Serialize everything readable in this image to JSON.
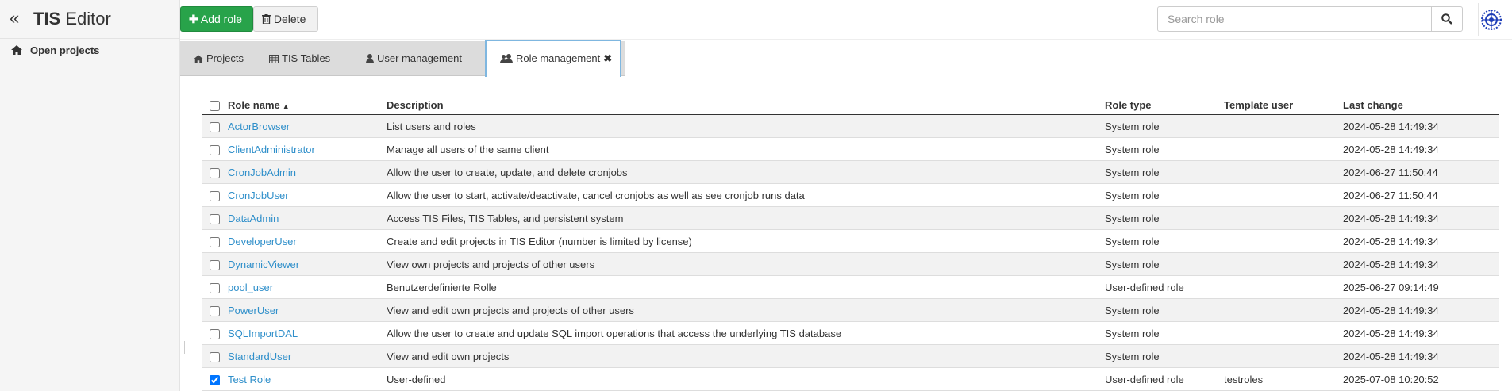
{
  "app": {
    "title_bold": "TIS",
    "title_rest": " Editor"
  },
  "sidebar": {
    "items": [
      {
        "label": "Open projects",
        "icon": "home-icon"
      }
    ]
  },
  "toolbar": {
    "add_label": "Add role",
    "delete_label": "Delete"
  },
  "search": {
    "placeholder": "Search role"
  },
  "tabs": [
    {
      "label": "Projects",
      "icon": "home-icon"
    },
    {
      "label": "TIS Tables",
      "icon": "table-icon"
    },
    {
      "label": "User management",
      "icon": "user-icon"
    },
    {
      "label": "Role management",
      "icon": "users-icon",
      "active": true
    }
  ],
  "table": {
    "columns": [
      "Role name",
      "Description",
      "Role type",
      "Template user",
      "Last change"
    ],
    "rows": [
      {
        "name": "ActorBrowser",
        "description": "List users and roles",
        "type": "System role",
        "template": "",
        "changed": "2024-05-28 14:49:34",
        "checked": false
      },
      {
        "name": "ClientAdministrator",
        "description": "Manage all users of the same client",
        "type": "System role",
        "template": "",
        "changed": "2024-05-28 14:49:34",
        "checked": false
      },
      {
        "name": "CronJobAdmin",
        "description": "Allow the user to create, update, and delete cronjobs",
        "type": "System role",
        "template": "",
        "changed": "2024-06-27 11:50:44",
        "checked": false
      },
      {
        "name": "CronJobUser",
        "description": "Allow the user to start, activate/deactivate, cancel cronjobs as well as see cronjob runs data",
        "type": "System role",
        "template": "",
        "changed": "2024-06-27 11:50:44",
        "checked": false
      },
      {
        "name": "DataAdmin",
        "description": "Access TIS Files, TIS Tables, and persistent system",
        "type": "System role",
        "template": "",
        "changed": "2024-05-28 14:49:34",
        "checked": false
      },
      {
        "name": "DeveloperUser",
        "description": "Create and edit projects in TIS Editor (number is limited by license)",
        "type": "System role",
        "template": "",
        "changed": "2024-05-28 14:49:34",
        "checked": false
      },
      {
        "name": "DynamicViewer",
        "description": "View own projects and projects of other users",
        "type": "System role",
        "template": "",
        "changed": "2024-05-28 14:49:34",
        "checked": false
      },
      {
        "name": "pool_user",
        "description": "Benutzerdefinierte Rolle",
        "type": "User-defined role",
        "template": "",
        "changed": "2025-06-27 09:14:49",
        "checked": false
      },
      {
        "name": "PowerUser",
        "description": "View and edit own projects and projects of other users",
        "type": "System role",
        "template": "",
        "changed": "2024-05-28 14:49:34",
        "checked": false
      },
      {
        "name": "SQLImportDAL",
        "description": "Allow the user to create and update SQL import operations that access the underlying TIS database",
        "type": "System role",
        "template": "",
        "changed": "2024-05-28 14:49:34",
        "checked": false
      },
      {
        "name": "StandardUser",
        "description": "View and edit own projects",
        "type": "System role",
        "template": "",
        "changed": "2024-05-28 14:49:34",
        "checked": false
      },
      {
        "name": "Test Role",
        "description": "User-defined",
        "type": "User-defined role",
        "template": "testroles",
        "changed": "2025-07-08 10:20:52",
        "checked": true
      }
    ]
  },
  "colors": {
    "primary_green": "#28a34a",
    "link_blue": "#2f8fca",
    "active_tab_border": "#7fb7e0",
    "sidebar_bg": "#f5f5f5"
  }
}
